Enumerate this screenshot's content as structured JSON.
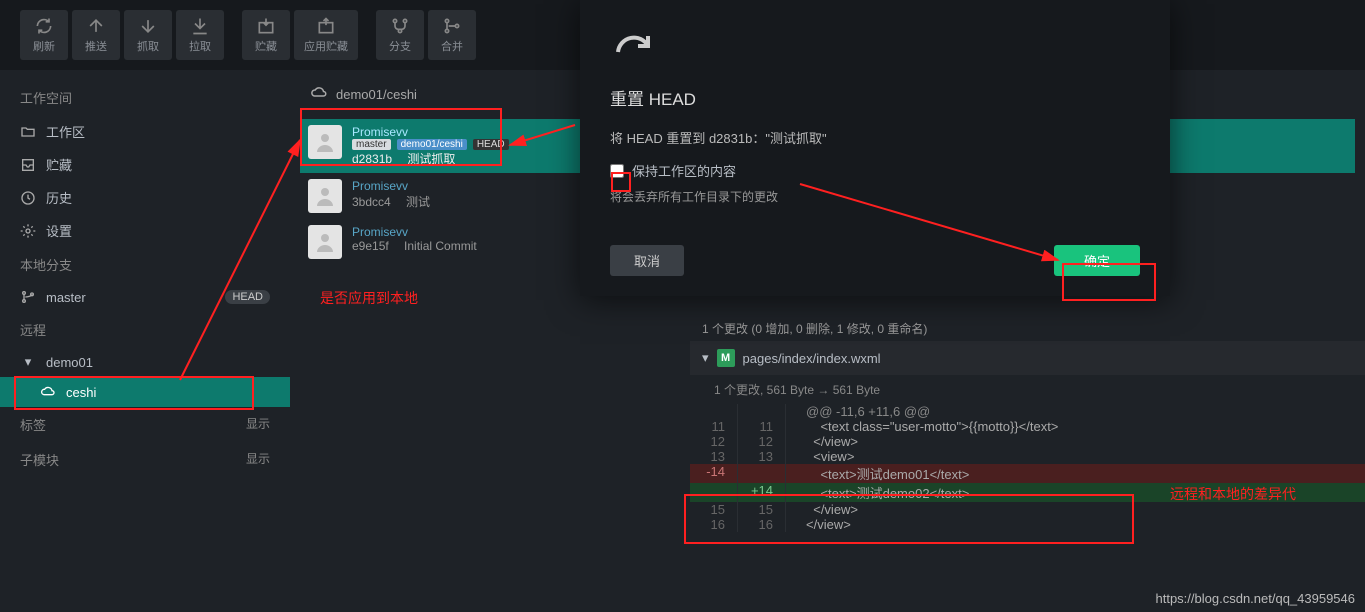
{
  "toolbar": {
    "refresh": "刷新",
    "push": "推送",
    "fetch": "抓取",
    "pull": "拉取",
    "stash": "贮藏",
    "apply_stash": "应用贮藏",
    "branch": "分支",
    "merge": "合并"
  },
  "sidebar": {
    "workspace_title": "工作空间",
    "workspace": {
      "label": "工作区"
    },
    "stash": {
      "label": "贮藏"
    },
    "history": {
      "label": "历史"
    },
    "settings": {
      "label": "设置"
    },
    "local_title": "本地分支",
    "master": {
      "label": "master",
      "badge": "HEAD"
    },
    "remote_title": "远程",
    "remote": {
      "label": "demo01"
    },
    "ceshi": {
      "label": "ceshi"
    },
    "tags_title": "标签",
    "submodule_title": "子模块",
    "show": "显示"
  },
  "breadcrumb": {
    "path": "demo01/ceshi"
  },
  "commits": [
    {
      "author": "Promisevv",
      "hash": "d2831b",
      "msg": "测试抓取",
      "tags": [
        "master",
        "demo01/ceshi",
        "HEAD"
      ],
      "selected": true
    },
    {
      "author": "Promisevv",
      "hash": "3bdcc4",
      "msg": "测试"
    },
    {
      "author": "Promisevv",
      "hash": "e9e15f",
      "msg": "Initial Commit"
    }
  ],
  "dialog": {
    "title": "重置 HEAD",
    "subtitle": "将 HEAD 重置到 d2831b：\"测试抓取\"",
    "checkbox": "保持工作区的内容",
    "warn": "将会丢弃所有工作目录下的更改",
    "cancel": "取消",
    "ok": "确定"
  },
  "diff": {
    "summary": "1 个更改 (0 增加, 0 删除, 1 修改, 0 重命名)",
    "file_badge": "M",
    "file": "pages/index/index.wxml",
    "meta": "1 个更改, 561 Byte → 561 Byte",
    "hunk": "@@ -11,6 +11,6 @@",
    "lines": [
      {
        "old": "11",
        "new": "11",
        "code": "    <text class=\"user-motto\">{{motto}}</text>"
      },
      {
        "old": "12",
        "new": "12",
        "code": "  </view>"
      },
      {
        "old": "13",
        "new": "13",
        "code": "  <view>"
      },
      {
        "old": "-14",
        "new": "",
        "code": "    <text>测试demo01</text>",
        "type": "del"
      },
      {
        "old": "",
        "new": "+14",
        "code": "    <text>测试demo02</text>",
        "type": "add"
      },
      {
        "old": "15",
        "new": "15",
        "code": "  </view>"
      },
      {
        "old": "16",
        "new": "16",
        "code": "</view>"
      }
    ]
  },
  "annotations": {
    "apply_local": "是否应用到本地",
    "remote_diff": "远程和本地的差异代",
    "watermark": "https://blog.csdn.net/qq_43959546"
  }
}
